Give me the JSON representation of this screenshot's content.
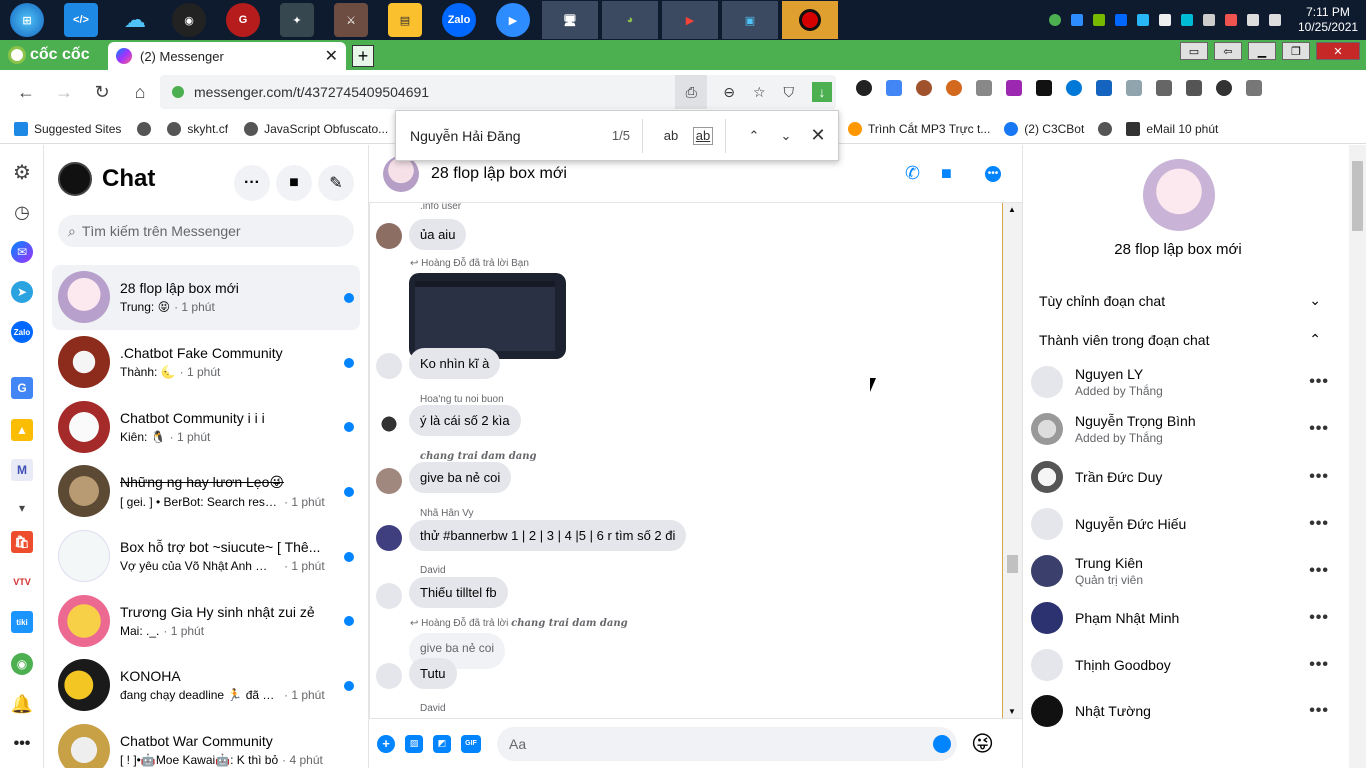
{
  "taskbar": {
    "apps": [
      "windows-start",
      "vscode",
      "onedrive",
      "obs",
      "garena",
      "anime-app",
      "game-app",
      "file-explorer",
      "zalo",
      "zoom",
      "remote-desktop",
      "coc-coc-app",
      "youtube-panda",
      "screen-app",
      "record-app"
    ],
    "clock": {
      "time": "7:11 PM",
      "date": "10/25/2021"
    }
  },
  "browser": {
    "brand": "cốc cốc",
    "tab_title": "(2) Messenger",
    "url": "messenger.com/t/4372745409504691",
    "bookmarks": [
      "Suggested Sites",
      "skyht.cf",
      "JavaScript Obfuscato..."
    ],
    "bookmarks_right": [
      "Trình Cắt MP3 Trực t...",
      "(2) C3CBot",
      "eMail 10 phút"
    ]
  },
  "findbar": {
    "query": "Nguyễn Hải Đăng",
    "count": "1/5",
    "match_case": "ab",
    "whole_word": "ab"
  },
  "chatlist": {
    "title": "Chat",
    "search_placeholder": "Tìm kiếm trên Messenger",
    "threads": [
      {
        "name": "28 flop lập box mới",
        "preview": "Trung: 😝",
        "time": "· 1 phút"
      },
      {
        "name": ".Chatbot Fake Community",
        "preview": "Thành: 🌜",
        "time": "· 1 phút"
      },
      {
        "name": "Chatbot Community i i i",
        "preview": "Kiên: 🐧",
        "time": "· 1 phút"
      },
      {
        "name": "Những ng hay lươn Lẹo😜",
        "preview": "[ gei. ] • BerBot: Search result...",
        "time": "· 1 phút"
      },
      {
        "name": "Box hỗ trợ bot ~siucute~ [ Thê...",
        "preview": "Vợ yêu của Võ Nhật Anh 💛: ...",
        "time": "· 1 phút"
      },
      {
        "name": "Trương Gia Hy sinh nhật zui zẻ",
        "preview": "Mai: ._.",
        "time": "· 1 phút"
      },
      {
        "name": "KONOHA",
        "preview": "đang chạy deadline 🏃 đã gử...",
        "time": "· 1 phút"
      },
      {
        "name": "Chatbot War Community",
        "preview": "[ ! ]•🤖Moe Kawai🤖: K thì bỏ",
        "time": "· 4 phút"
      }
    ]
  },
  "conversation": {
    "title": "28 flop lập box mới",
    "messages": {
      "m1_sender": ".info user",
      "m1_text": "ủa aiu",
      "m2_reply": "Hoàng Đỗ đã trả lời Bạn",
      "m2_text": "Ko nhìn kĩ à",
      "m3_sender": "Hoa'ng tu noi buon",
      "m3_text": "ý là cái số 2 kìa",
      "m4_sender": "chang trai dam dang",
      "m4_text": "give ba nẻ coi",
      "m5_sender": "Nhã Hân Vy",
      "m5_text": "thử #bannerbw 1 | 2 | 3 | 4 |5 | 6 r tìm số 2 đi",
      "m6_sender": "David",
      "m6_text": "Thiếu tilltel fb",
      "m7_reply_prefix": "Hoàng Đỗ đã trả lời",
      "m7_reply_target": "chang trai dam dang",
      "m7_quoted": "give ba nẻ coi",
      "m7_text": "Tutu",
      "m8_sender": "David"
    },
    "composer_placeholder": "Aa",
    "gif_label": "GIF"
  },
  "rightpanel": {
    "title": "28 flop lập box mới",
    "section1": "Tùy chỉnh đoạn chat",
    "section2": "Thành viên trong đoạn chat",
    "members": [
      {
        "name": "Nguyen LY",
        "sub": "Added by Thắng"
      },
      {
        "name": "Nguyễn Trọng Bình",
        "sub": "Added by Thắng"
      },
      {
        "name": "Trần Đức Duy",
        "sub": ""
      },
      {
        "name": "Nguyễn Đức Hiếu",
        "sub": ""
      },
      {
        "name": "Trung Kiên",
        "sub": "Quản trị viên"
      },
      {
        "name": "Phạm Nhật Minh",
        "sub": ""
      },
      {
        "name": "Thịnh Goodboy",
        "sub": ""
      },
      {
        "name": "Nhật Tường",
        "sub": ""
      }
    ]
  },
  "colors": {
    "accent": "#0084ff",
    "browser_green": "#4caf50",
    "taskbar": "#0e1b2e"
  }
}
